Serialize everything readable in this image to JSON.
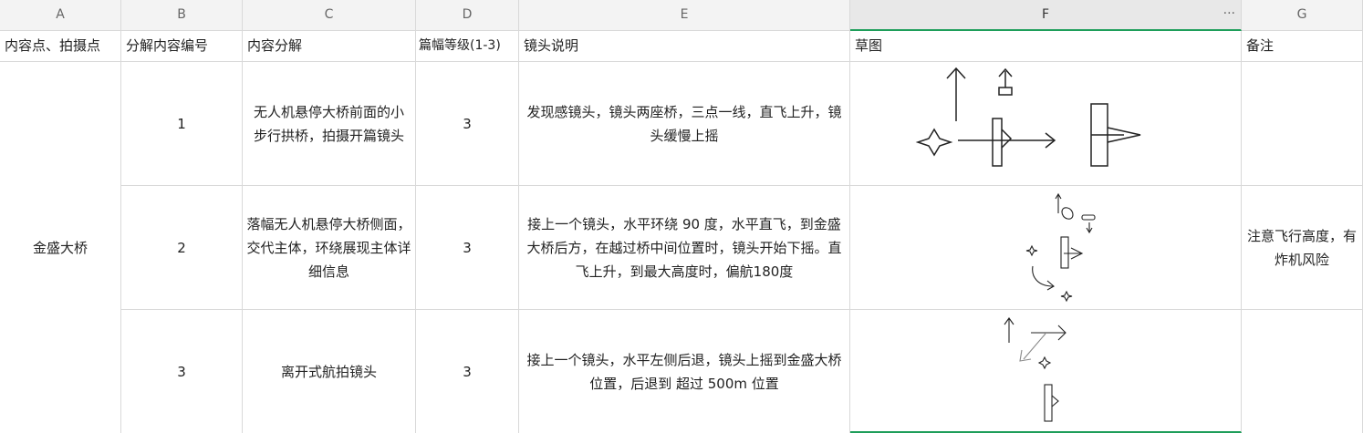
{
  "columns": [
    "A",
    "B",
    "C",
    "D",
    "E",
    "F",
    "G"
  ],
  "column_menu": "···",
  "header_row": {
    "a": "内容点、拍摄点",
    "b": "分解内容编号",
    "c": "内容分解",
    "d": "篇幅等级(1-3)",
    "e": "镜头说明",
    "f": "草图",
    "g": "备注"
  },
  "merged_a": "金盛大桥",
  "rows": [
    {
      "b": "1",
      "c": "无人机悬停大桥前面的小步行拱桥，拍摄开篇镜头",
      "d": "3",
      "e": "发现感镜头，镜头两座桥，三点一线，直飞上升，镜头缓慢上摇",
      "g": ""
    },
    {
      "b": "2",
      "c": "落幅无人机悬停大桥侧面，交代主体，环绕展现主体详细信息",
      "d": "3",
      "e": "接上一个镜头，水平环绕 90 度，水平直飞，到金盛大桥后方，在越过桥中间位置时，镜头开始下摇。直飞上升，到最大高度时，偏航180度",
      "g": "注意飞行高度，有炸机风险"
    },
    {
      "b": "3",
      "c": "离开式航拍镜头",
      "d": "3",
      "e": "接上一个镜头，水平左侧后退，镜头上摇到金盛大桥位置，后退到 超过 500m 位置",
      "g": ""
    }
  ],
  "colors": {
    "header_bg": "#f3f3f3",
    "grid_line": "#d9d9d9",
    "selection": "#1e9e5a"
  }
}
